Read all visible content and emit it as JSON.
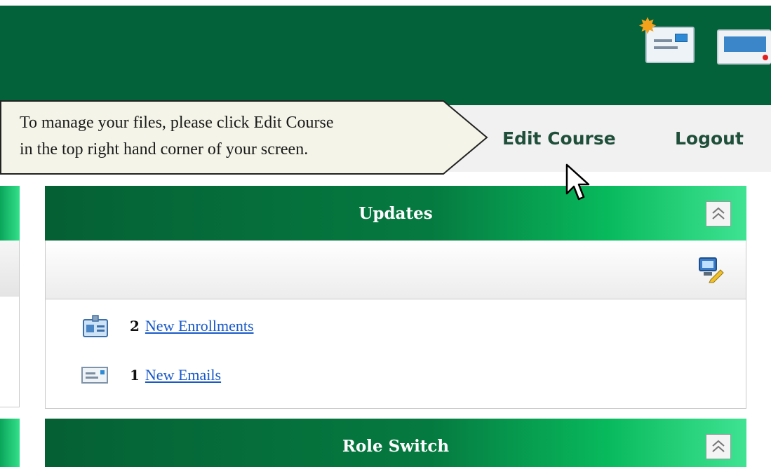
{
  "callout": {
    "line1": "To manage your files, please click Edit Course",
    "line2": "in the top right hand corner of your screen."
  },
  "toolbar": {
    "edit_course": "Edit Course",
    "logout": "Logout"
  },
  "header": {
    "icons": [
      "new-mail-icon",
      "mail-icon"
    ]
  },
  "panels": {
    "updates": {
      "title": "Updates",
      "items": [
        {
          "count": "2",
          "label": "New Enrollments",
          "icon": "enrollment-icon"
        },
        {
          "count": "1",
          "label": "New Emails",
          "icon": "email-icon"
        }
      ]
    },
    "role_switch": {
      "title": "Role Switch"
    }
  },
  "colors": {
    "header_green": "#04623a",
    "accent_green": "#08b95c",
    "link_blue": "#1a5ac8"
  }
}
